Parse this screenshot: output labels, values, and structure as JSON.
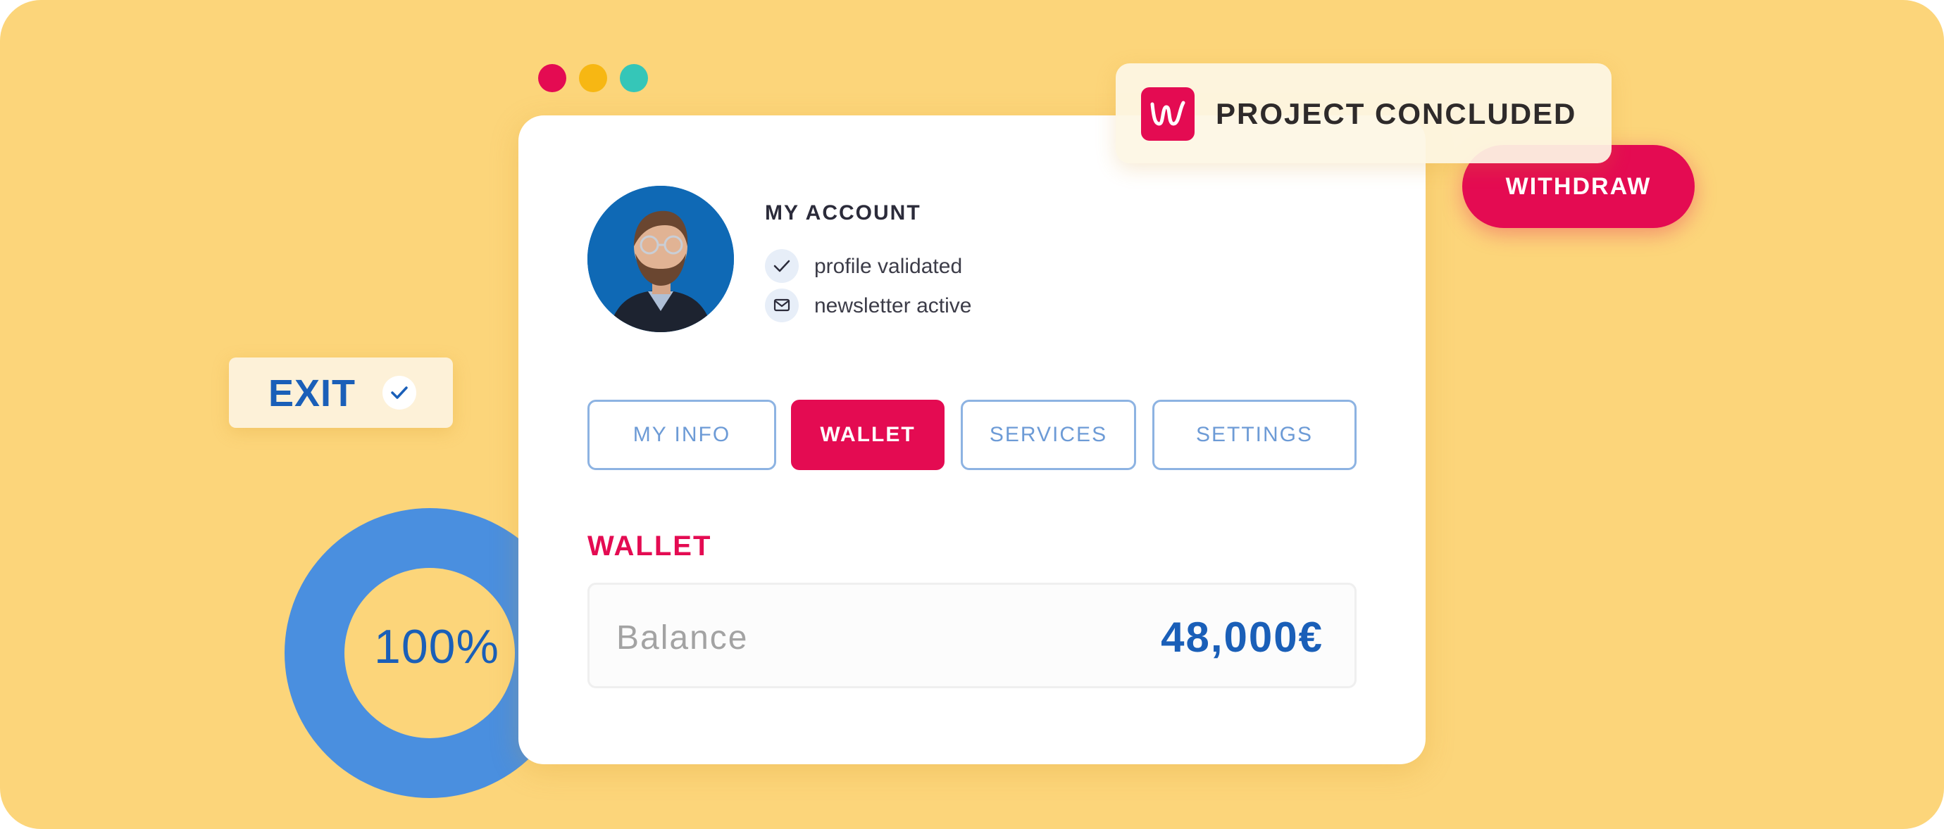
{
  "window_controls": [
    "close",
    "minimize",
    "maximize"
  ],
  "progress": {
    "label": "100%",
    "value_percent": 100
  },
  "exit_chip": {
    "label": "EXIT",
    "icon": "check-icon"
  },
  "account": {
    "title": "MY ACCOUNT",
    "statuses": [
      {
        "icon": "check-icon",
        "text": "profile validated"
      },
      {
        "icon": "mail-icon",
        "text": "newsletter active"
      }
    ]
  },
  "tabs": [
    {
      "label": "MY INFO",
      "active": false
    },
    {
      "label": "WALLET",
      "active": true
    },
    {
      "label": "SERVICES",
      "active": false
    },
    {
      "label": "SETTINGS",
      "active": false
    }
  ],
  "wallet": {
    "heading": "WALLET",
    "balance_label": "Balance",
    "balance_value": "48,000€"
  },
  "withdraw_button": {
    "label": "WITHDRAW"
  },
  "toast": {
    "text": "PROJECT CONCLUDED",
    "logo": "brand-logo-icon"
  },
  "colors": {
    "background": "#fcd57a",
    "accent": "#e40b52",
    "primary_blue": "#1a5fb8",
    "donut_blue": "#4a8fdf",
    "dot_red": "#e40b52",
    "dot_yellow": "#f7b713",
    "dot_green": "#35c6b8"
  }
}
